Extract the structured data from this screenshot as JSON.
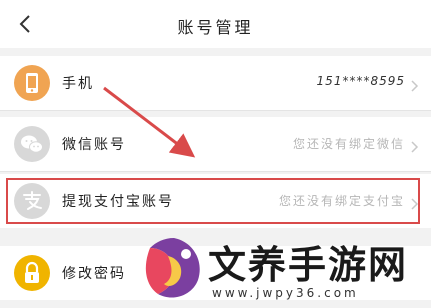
{
  "header": {
    "title": "账号管理"
  },
  "rows": [
    {
      "label": "手机",
      "value": "151****8595",
      "icon": "phone-icon",
      "icon_color": "#f0a452"
    },
    {
      "label": "微信账号",
      "value": "您还没有绑定微信",
      "icon": "wechat-icon",
      "icon_color": "#d8d8d8"
    },
    {
      "label": "提现支付宝账号",
      "value": "您还没有绑定支付宝",
      "icon": "alipay-icon",
      "icon_color": "#d8d8d8"
    },
    {
      "label": "修改密码",
      "value": "",
      "icon": "lock-icon",
      "icon_color": "#f0b400"
    }
  ],
  "annotation": {
    "color": "#d94a4a"
  },
  "watermark": {
    "title": "文养手游网",
    "url": "www.jwpy36.com"
  }
}
